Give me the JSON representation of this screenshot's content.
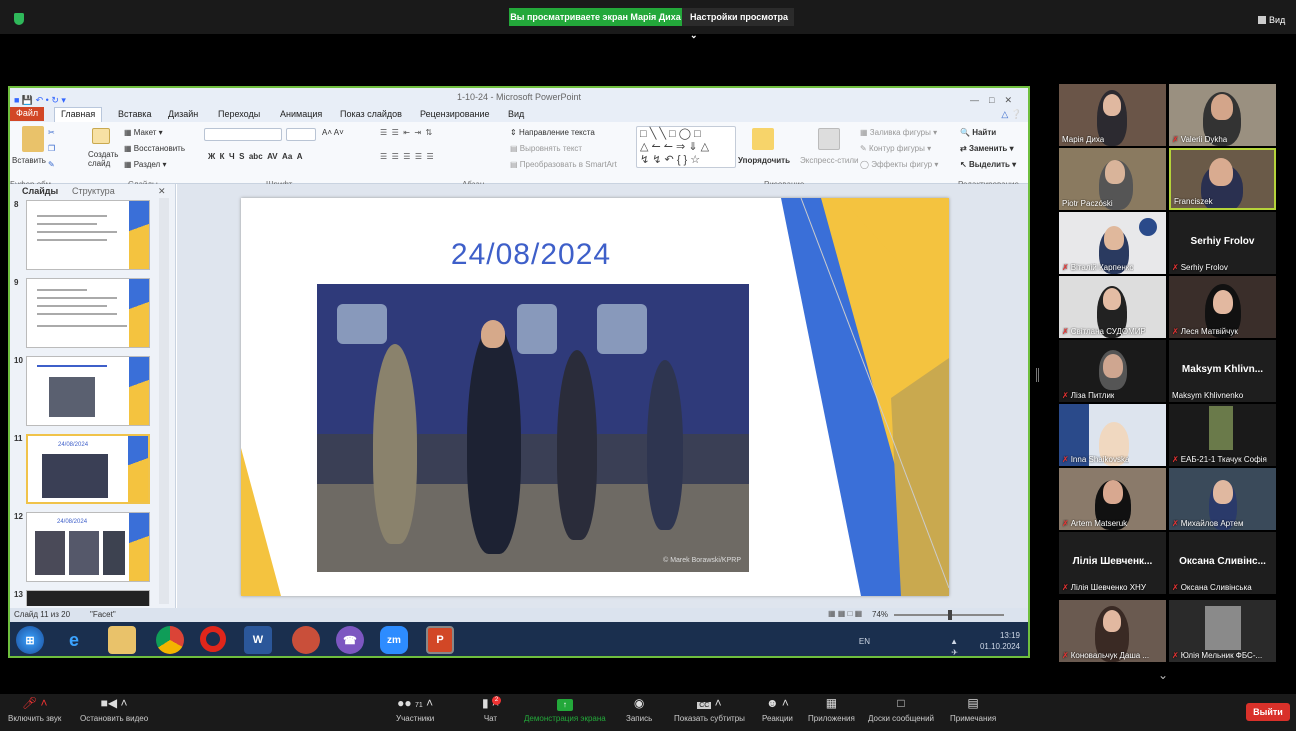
{
  "zoom": {
    "share_banner": "Вы просматриваете экран Марія Диха",
    "view_options": "Настройки просмотра",
    "view_button": "Вид",
    "toolbar": {
      "mute": "Включить звук",
      "video": "Остановить видео",
      "participants": "Участники",
      "participants_count": "71",
      "chat": "Чат",
      "chat_badge": "2",
      "share": "Демонстрация экрана",
      "record": "Запись",
      "captions": "Показать субтитры",
      "reactions": "Реакции",
      "apps": "Приложения",
      "whiteboards": "Доски сообщений",
      "notes": "Примечания",
      "leave": "Выйти"
    },
    "participants": [
      {
        "name": "Марія Диха",
        "muted": false
      },
      {
        "name": "Valerii Dykha",
        "muted": true
      },
      {
        "name": "Piotr Paczóski",
        "muted": false
      },
      {
        "name": "Franciszek",
        "muted": false
      },
      {
        "name": "Віталій Карпенко",
        "muted": true
      },
      {
        "name": "Serhiy Frolov",
        "muted": true,
        "display": "Serhiy Frolov"
      },
      {
        "name": "Світлана СУДОМИР",
        "muted": true
      },
      {
        "name": "Леся Матвійчук",
        "muted": true
      },
      {
        "name": "Ліза Питлик",
        "muted": true
      },
      {
        "name": "Maksym Khlivnenko",
        "muted": false,
        "display": "Maksym Khlivn..."
      },
      {
        "name": "Inna Shaikovska",
        "muted": true
      },
      {
        "name": "ЕАБ-21-1 Ткачук Софія",
        "muted": true
      },
      {
        "name": "Artem Matseruk",
        "muted": true
      },
      {
        "name": "Михайлов Артем",
        "muted": true
      },
      {
        "name": "Лілія Шевченко ХНУ",
        "muted": true,
        "display": "Лілія Шевченк..."
      },
      {
        "name": "Оксана Сливінська",
        "muted": true,
        "display": "Оксана Сливінс..."
      },
      {
        "name": "Коновальчук Даша ...",
        "muted": true
      },
      {
        "name": "Юлія Мельник ФБС-...",
        "muted": true
      }
    ]
  },
  "powerpoint": {
    "window_title": "1-10-24 - Microsoft PowerPoint",
    "tabs": [
      "Файл",
      "Главная",
      "Вставка",
      "Дизайн",
      "Переходы",
      "Анимация",
      "Показ слайдов",
      "Рецензирование",
      "Вид"
    ],
    "ribbon": {
      "paste": "Вставить",
      "clipboard": "Буфер обм...",
      "create_slide": "Создать слайд",
      "layout": "Макет",
      "restore": "Восстановить",
      "section": "Раздел",
      "slides_group": "Слайды",
      "font_group": "Шрифт",
      "paragraph_group": "Абзац",
      "text_direction": "Направление текста",
      "align_text": "Выровнять текст",
      "smartart": "Преобразовать в SmartArt",
      "arrange": "Упорядочить",
      "quick_styles": "Экспресс-стили",
      "shape_fill": "Заливка фигуры",
      "shape_outline": "Контур фигуры",
      "shape_effects": "Эффекты фигур",
      "drawing_group": "Рисование",
      "find": "Найти",
      "replace": "Заменить",
      "select": "Выделить",
      "editing_group": "Редактирование"
    },
    "pane_tabs": [
      "Слайды",
      "Структура"
    ],
    "slide_numbers": [
      "8",
      "9",
      "10",
      "11",
      "12",
      "13"
    ],
    "thumb_date": "24/08/2024",
    "slide_date": "24/08/2024",
    "photo_credit": "© Marek Borawski/KPRP",
    "status_slide": "Слайд 11 из 20",
    "status_theme": "\"Facet\"",
    "zoom_level": "74%",
    "language": "EN",
    "time": "13:19",
    "date": "01.10.2024"
  },
  "colors": {
    "accent_green": "#23a83a",
    "leave_red": "#d9312a",
    "slide_blue": "#3e5fc9",
    "slide_yellow": "#f4c33f"
  }
}
